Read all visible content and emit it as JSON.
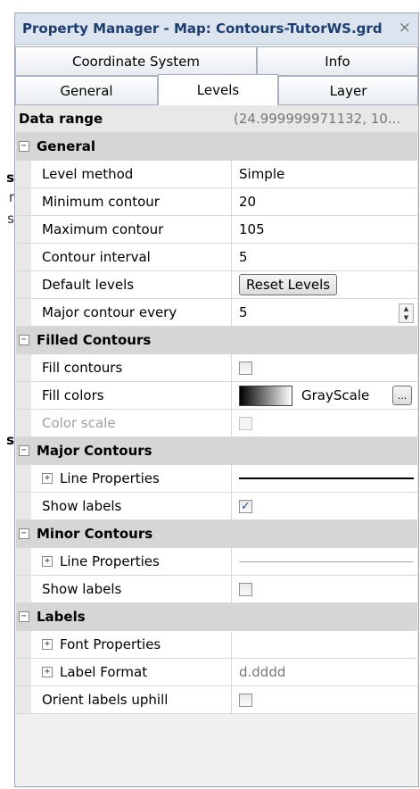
{
  "background_fragments": [
    "s",
    "r",
    "s",
    "s"
  ],
  "window": {
    "title": "Property Manager - Map: Contours-TutorWS.grd",
    "close_label": "×"
  },
  "tabs": {
    "row1": [
      "Coordinate System",
      "Info"
    ],
    "row2": [
      "General",
      "Levels",
      "Layer"
    ],
    "active": "Levels"
  },
  "data_range": {
    "label": "Data range",
    "value": "(24.999999971132, 10..."
  },
  "sections": {
    "general": {
      "label": "General",
      "level_method": {
        "label": "Level method",
        "value": "Simple"
      },
      "minimum_contour": {
        "label": "Minimum contour",
        "value": "20"
      },
      "maximum_contour": {
        "label": "Maximum contour",
        "value": "105"
      },
      "contour_interval": {
        "label": "Contour interval",
        "value": "5"
      },
      "default_levels": {
        "label": "Default levels",
        "button": "Reset Levels"
      },
      "major_contour_every": {
        "label": "Major contour every",
        "value": "5"
      }
    },
    "filled_contours": {
      "label": "Filled Contours",
      "fill_contours": {
        "label": "Fill contours",
        "checked": false
      },
      "fill_colors": {
        "label": "Fill colors",
        "value": "GrayScale",
        "button": "..."
      },
      "color_scale": {
        "label": "Color scale",
        "checked": false,
        "disabled": true
      }
    },
    "major_contours": {
      "label": "Major Contours",
      "line_properties": {
        "label": "Line Properties"
      },
      "show_labels": {
        "label": "Show labels",
        "checked": true
      }
    },
    "minor_contours": {
      "label": "Minor Contours",
      "line_properties": {
        "label": "Line Properties"
      },
      "show_labels": {
        "label": "Show labels",
        "checked": false
      }
    },
    "labels": {
      "label": "Labels",
      "font_properties": {
        "label": "Font Properties"
      },
      "label_format": {
        "label": "Label Format",
        "value": "d.dddd"
      },
      "orient_labels_uphill": {
        "label": "Orient labels uphill",
        "checked": false
      }
    }
  },
  "glyphs": {
    "collapse": "−",
    "expand": "+",
    "check": "✓",
    "spin_up": "▲",
    "spin_down": "▼"
  }
}
